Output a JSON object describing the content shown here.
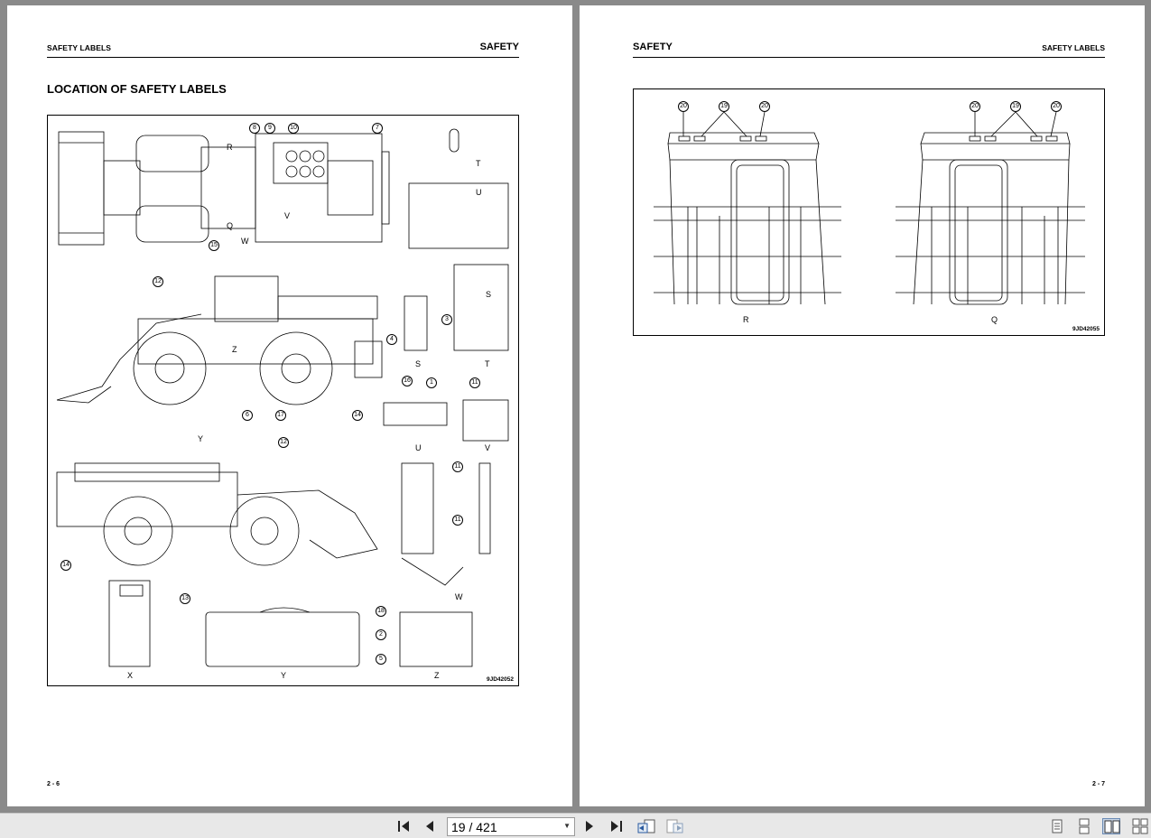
{
  "left_page": {
    "header_left": "SAFETY LABELS",
    "header_right": "SAFETY",
    "section_title": "LOCATION OF SAFETY LABELS",
    "figure_code": "9JD42052",
    "page_number": "2 - 6",
    "view_labels": [
      "S",
      "T",
      "U",
      "V",
      "W",
      "X",
      "Y",
      "Z"
    ],
    "arrow_labels": [
      "R",
      "Q",
      "W",
      "V",
      "T",
      "U",
      "S",
      "Z",
      "Y"
    ],
    "callouts": [
      "1",
      "2",
      "3",
      "4",
      "5",
      "6",
      "7",
      "8",
      "9",
      "10",
      "11",
      "12",
      "13",
      "14",
      "15",
      "16",
      "17",
      "18"
    ]
  },
  "right_page": {
    "header_left": "SAFETY",
    "header_right": "SAFETY LABELS",
    "figure_code": "9JD42055",
    "page_number": "2 - 7",
    "view_labels": [
      "R",
      "Q"
    ],
    "callouts": [
      "19",
      "20"
    ]
  },
  "toolbar": {
    "current_page": "19",
    "page_separator": " / ",
    "total_pages": "421",
    "icons": [
      "first-page-icon",
      "prev-page-icon",
      "next-page-icon",
      "last-page-icon",
      "go-back-icon",
      "go-forward-icon",
      "single-page-icon",
      "continuous-page-icon",
      "facing-pages-icon",
      "continuous-facing-icon"
    ]
  }
}
